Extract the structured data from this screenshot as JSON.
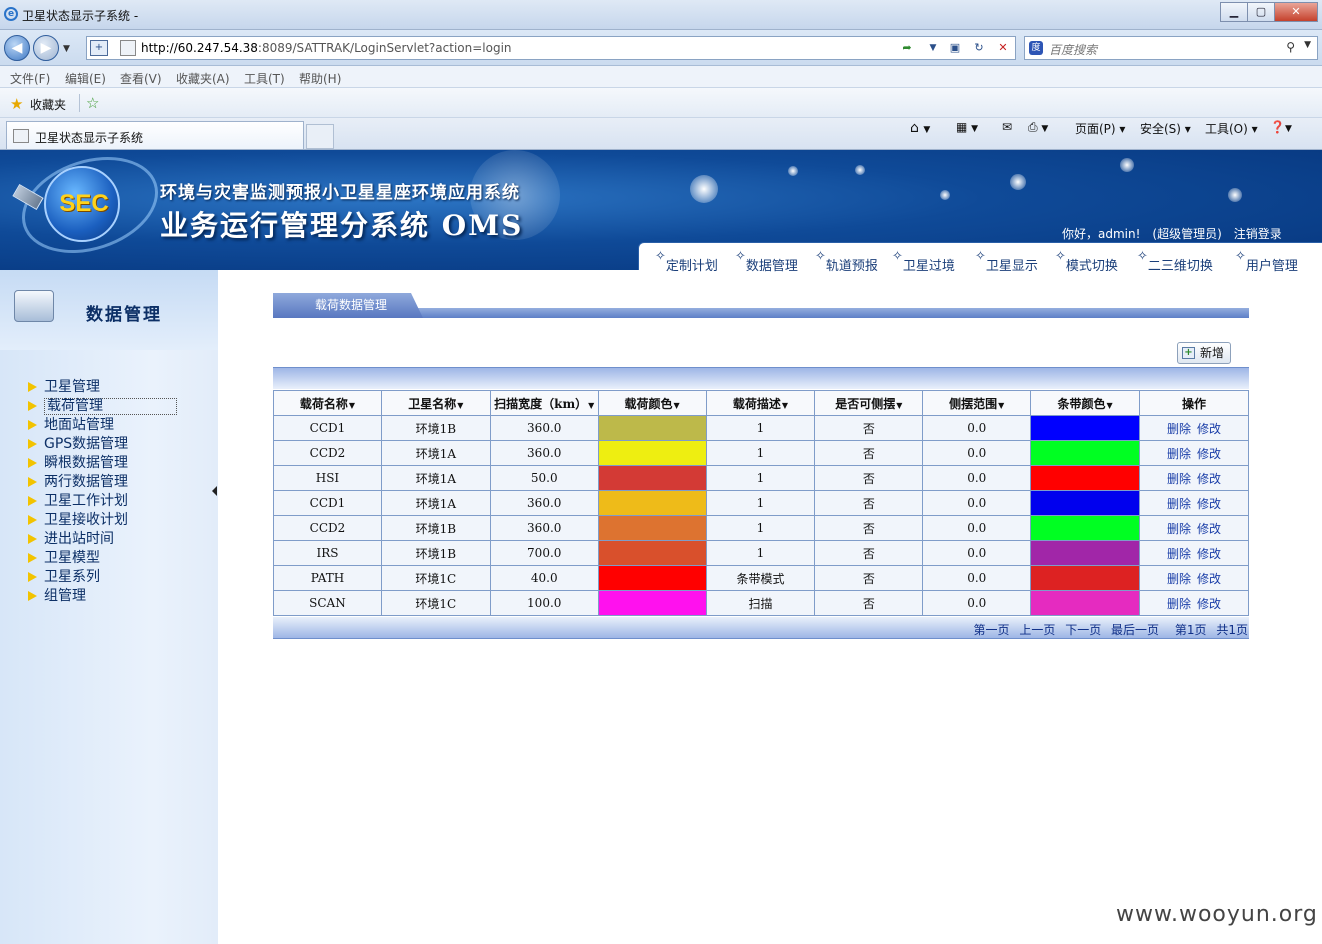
{
  "window": {
    "title": "卫星状态显示子系统 -",
    "buttons": [
      "▁",
      "▢",
      "✕"
    ]
  },
  "address": {
    "url_host": "http://60.247.54.38",
    "url_rest": ":8089/SATTRAK/LoginServlet?action=login",
    "search_placeholder": "百度搜索"
  },
  "menu": [
    "文件(F)",
    "编辑(E)",
    "查看(V)",
    "收藏夹(A)",
    "工具(T)",
    "帮助(H)"
  ],
  "favorites": {
    "label": "收藏夹"
  },
  "tab": {
    "title": "卫星状态显示子系统"
  },
  "command_bar": [
    "页面(P) ▾",
    "安全(S) ▾",
    "工具(O) ▾"
  ],
  "header": {
    "line1": "环境与灾害监测预报小卫星星座环境应用系统",
    "line2": "业务运行管理分系统 OMS",
    "logo": "SEC",
    "user": "你好，admin!　(超级管理员)　注销登录"
  },
  "nav": [
    "定制计划",
    "数据管理",
    "轨道预报",
    "卫星过境",
    "卫星显示",
    "模式切换",
    "二三维切换",
    "用户管理"
  ],
  "sidebar": {
    "title": "数据管理",
    "items": [
      "卫星管理",
      "载荷管理",
      "地面站管理",
      "GPS数据管理",
      "瞬根数据管理",
      "两行数据管理",
      "卫星工作计划",
      "卫星接收计划",
      "进出站时间",
      "卫星模型",
      "卫星系列",
      "组管理"
    ],
    "active_index": 1
  },
  "panel": {
    "tab_label": "载荷数据管理",
    "add_button": "新增"
  },
  "table": {
    "headers": [
      "载荷名称",
      "卫星名称",
      "扫描宽度（km）",
      "载荷颜色",
      "载荷描述",
      "是否可侧摆",
      "侧摆范围",
      "条带颜色",
      "操作"
    ],
    "sortable": [
      true,
      true,
      true,
      true,
      true,
      true,
      true,
      true,
      false
    ],
    "rows": [
      {
        "payload": "CCD1",
        "satellite": "环境1B",
        "width": "360.0",
        "payload_color": "#bdb94a",
        "desc": "1",
        "tilt": "否",
        "range": "0.0",
        "strip_color": "#0000ff"
      },
      {
        "payload": "CCD2",
        "satellite": "环境1A",
        "width": "360.0",
        "payload_color": "#eeee11",
        "desc": "1",
        "tilt": "否",
        "range": "0.0",
        "strip_color": "#00ff22"
      },
      {
        "payload": "HSI",
        "satellite": "环境1A",
        "width": "50.0",
        "payload_color": "#d33a35",
        "desc": "1",
        "tilt": "否",
        "range": "0.0",
        "strip_color": "#ff0000"
      },
      {
        "payload": "CCD1",
        "satellite": "环境1A",
        "width": "360.0",
        "payload_color": "#eebb19",
        "desc": "1",
        "tilt": "否",
        "range": "0.0",
        "strip_color": "#0000ee"
      },
      {
        "payload": "CCD2",
        "satellite": "环境1B",
        "width": "360.0",
        "payload_color": "#dd7330",
        "desc": "1",
        "tilt": "否",
        "range": "0.0",
        "strip_color": "#00ff22"
      },
      {
        "payload": "IRS",
        "satellite": "环境1B",
        "width": "700.0",
        "payload_color": "#d9502c",
        "desc": "1",
        "tilt": "否",
        "range": "0.0",
        "strip_color": "#a126a8"
      },
      {
        "payload": "PATH",
        "satellite": "环境1C",
        "width": "40.0",
        "payload_color": "#ff0000",
        "desc": "条带模式",
        "tilt": "否",
        "range": "0.0",
        "strip_color": "#dd2222"
      },
      {
        "payload": "SCAN",
        "satellite": "环境1C",
        "width": "100.0",
        "payload_color": "#ff11ee",
        "desc": "扫描",
        "tilt": "否",
        "range": "0.0",
        "strip_color": "#e52bc0"
      }
    ],
    "op_delete": "删除",
    "op_edit": "修改"
  },
  "pager": [
    "第一页",
    "上一页",
    "下一页",
    "最后一页",
    "第1页",
    "共1页"
  ],
  "watermark": "www.wooyun.org"
}
